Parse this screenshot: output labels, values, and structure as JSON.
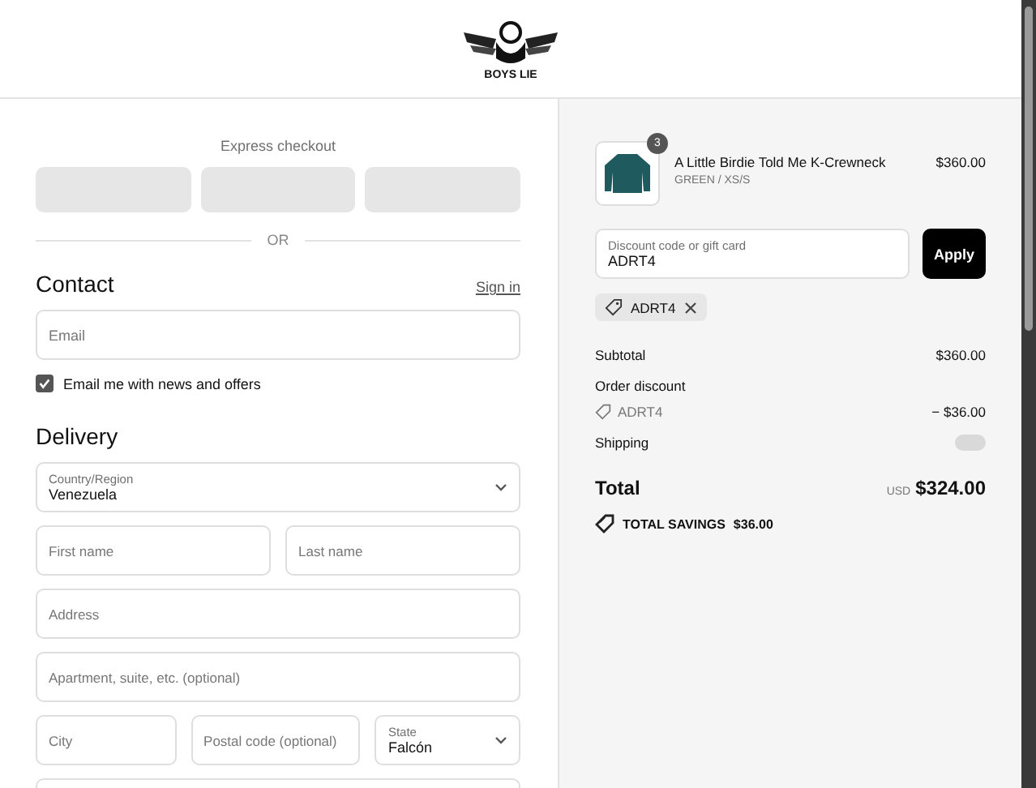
{
  "header": {
    "logo_text": "BOYS LIE"
  },
  "express_checkout": {
    "title": "Express checkout",
    "divider": "OR"
  },
  "contact": {
    "heading": "Contact",
    "sign_in": "Sign in",
    "email": {
      "placeholder": "Email"
    },
    "newsletter": {
      "label": "Email me with news and offers",
      "checked": true
    }
  },
  "delivery": {
    "heading": "Delivery",
    "rows": [
      {
        "fields": [
          {
            "kind": "select",
            "label": "Country/Region",
            "value": "Venezuela"
          }
        ]
      },
      {
        "fields": [
          {
            "kind": "input",
            "placeholder": "First name"
          },
          {
            "kind": "input",
            "placeholder": "Last name"
          }
        ]
      },
      {
        "fields": [
          {
            "kind": "input",
            "placeholder": "Address"
          }
        ]
      },
      {
        "fields": [
          {
            "kind": "input",
            "placeholder": "Apartment, suite, etc. (optional)"
          }
        ]
      },
      {
        "fields": [
          {
            "kind": "input",
            "placeholder": "City"
          },
          {
            "kind": "input",
            "placeholder": "Postal code (optional)"
          },
          {
            "kind": "select",
            "label": "State",
            "value": "Falcón"
          }
        ]
      }
    ]
  },
  "summary": {
    "item": {
      "name": "A Little Birdie Told Me K-Crewneck",
      "variant": "GREEN / XS/S",
      "price": "$360.00",
      "quantity": "3"
    },
    "discount": {
      "label": "Discount code or gift card",
      "value": "ADRT4",
      "button": "Apply",
      "applied_code": "ADRT4"
    },
    "subtotal": {
      "label": "Subtotal",
      "value": "$360.00"
    },
    "order_discount": {
      "label": "Order discount",
      "code": "ADRT4",
      "value": "− $36.00"
    },
    "shipping": {
      "label": "Shipping"
    },
    "total": {
      "label": "Total",
      "currency": "USD",
      "value": "$324.00"
    },
    "savings": {
      "label": "TOTAL SAVINGS",
      "value": "$36.00"
    }
  }
}
